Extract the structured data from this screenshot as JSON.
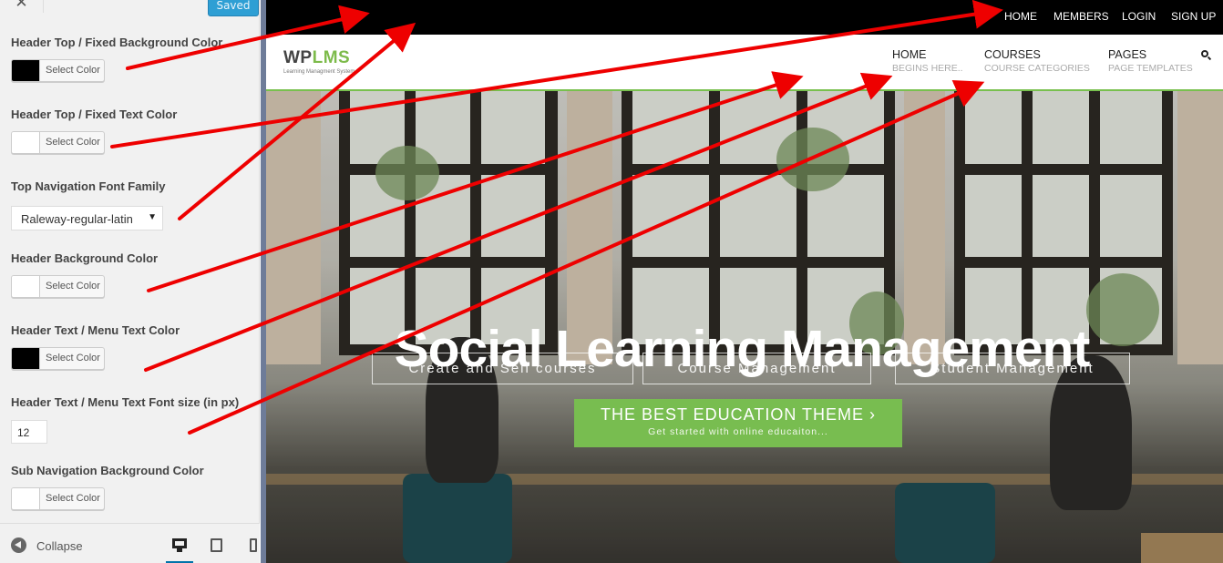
{
  "customizer": {
    "saved_label": "Saved",
    "close_glyph": "✕",
    "controls": [
      {
        "label": "Header Top / Fixed Background Color",
        "type": "color",
        "swatch": "#000000",
        "button": "Select Color"
      },
      {
        "label": "Header Top / Fixed Text Color",
        "type": "color",
        "swatch": "#ffffff",
        "button": "Select Color"
      },
      {
        "label": "Top Navigation Font Family",
        "type": "select",
        "value": "Raleway-regular-latin"
      },
      {
        "label": "Header Background Color",
        "type": "color",
        "swatch": "#ffffff",
        "button": "Select Color"
      },
      {
        "label": "Header Text / Menu Text Color",
        "type": "color",
        "swatch": "#000000",
        "button": "Select Color"
      },
      {
        "label": "Header Text / Menu Text Font size (in px)",
        "type": "number",
        "value": "12"
      },
      {
        "label": "Sub Navigation Background Color",
        "type": "color",
        "swatch": "#ffffff",
        "button": "Select Color"
      }
    ],
    "footer": {
      "collapse_label": "Collapse",
      "devices": [
        "desktop-icon",
        "tablet-icon",
        "mobile-icon"
      ],
      "active_device": "desktop"
    }
  },
  "preview": {
    "top_bar": {
      "background": "#000000",
      "links": [
        "HOME",
        "MEMBERS",
        "LOGIN",
        "SIGN UP"
      ]
    },
    "header": {
      "logo_wp": "WP",
      "logo_lms": "LMS",
      "logo_tagline": "Learning Managment System",
      "accent_color": "#78c04e",
      "nav": [
        {
          "label": "HOME",
          "sub": "BEGINS HERE.."
        },
        {
          "label": "COURSES",
          "sub": "COURSE CATEGORIES"
        },
        {
          "label": "PAGES",
          "sub": "PAGE TEMPLATES"
        }
      ],
      "search_icon": "search-icon"
    },
    "hero": {
      "buttons": [
        "Create and Sell courses",
        "Course Management",
        "Student Management"
      ],
      "title": "Social Learning Management",
      "cta_main": "THE BEST EDUCATION THEME ›",
      "cta_sub": "Get started with online educaiton...",
      "cta_color": "#78bd50"
    }
  },
  "annotation_color": "#ee0000"
}
